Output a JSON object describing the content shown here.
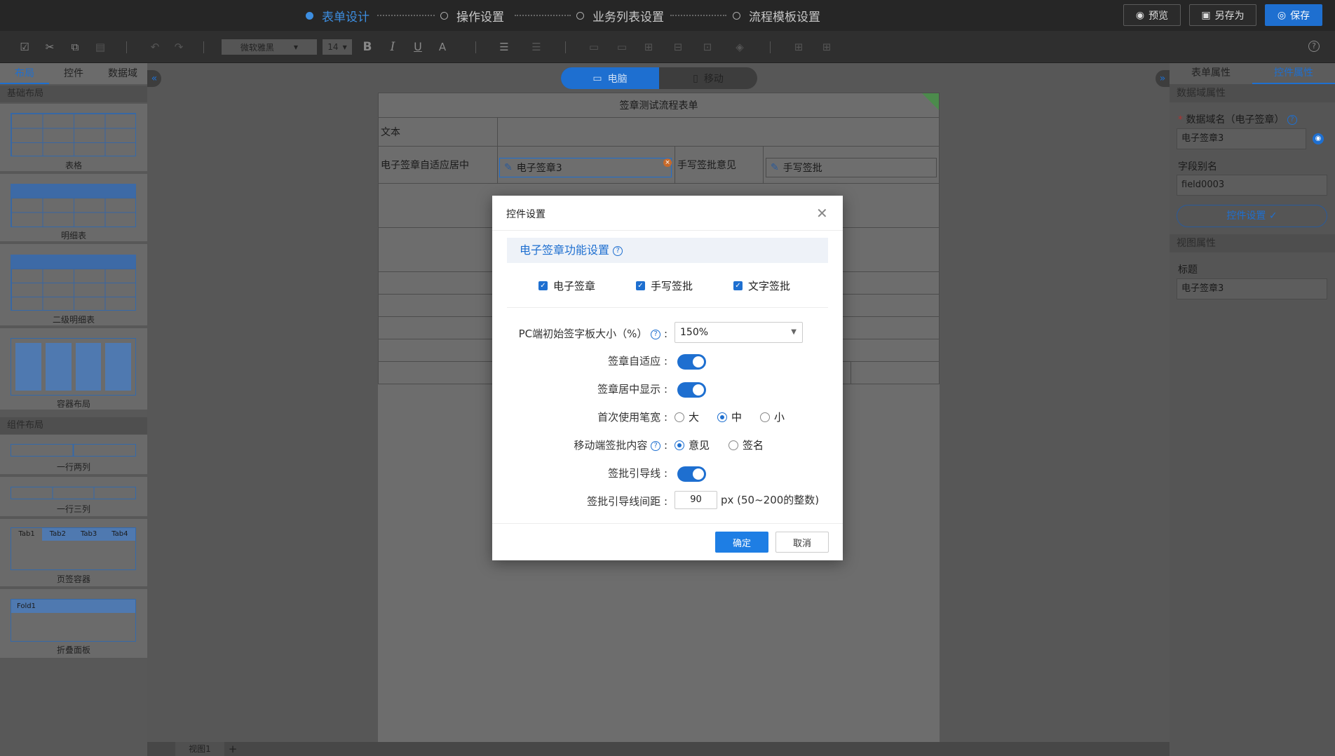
{
  "steps": [
    "表单设计",
    "操作设置",
    "业务列表设置",
    "流程模板设置"
  ],
  "top_buttons": {
    "preview": "预览",
    "save_as": "另存为",
    "save": "保存"
  },
  "toolbar": {
    "font": "微软雅黑",
    "size": "14",
    "bold": "B",
    "italic": "I",
    "underline": "U",
    "color": "A"
  },
  "left": {
    "tabs": [
      "布局",
      "控件",
      "数据域"
    ],
    "basic_section": "基础布局",
    "component_section": "组件布局",
    "items": {
      "table": "表格",
      "detail": "明细表",
      "detail2": "二级明细表",
      "container": "容器布局",
      "row2": "一行两列",
      "row3": "一行三列",
      "tabs": "页签容器",
      "fold": "折叠面板"
    },
    "tab_names": [
      "Tab1",
      "Tab2",
      "Tab3",
      "Tab4"
    ],
    "fold_name": "Fold1"
  },
  "device": {
    "pc": "电脑",
    "mobile": "移动"
  },
  "form": {
    "title": "签章测试流程表单",
    "row1_label": "文本",
    "row2_label": "电子签章自适应居中",
    "sig_control": "电子签章3",
    "handwrite_label": "手写签批意见",
    "handwrite_control": "手写签批"
  },
  "right": {
    "tabs": [
      "表单属性",
      "控件属性"
    ],
    "data_section": "数据域属性",
    "field_name_label": "数据域名（电子签章）",
    "field_name_value": "电子签章3",
    "alias_label": "字段别名",
    "alias_value": "field0003",
    "control_settings_btn": "控件设置 ✓",
    "view_section": "视图属性",
    "title_label": "标题",
    "title_value": "电子签章3"
  },
  "bottom": {
    "view_tab": "视图1",
    "add": "+"
  },
  "modal": {
    "title": "控件设置",
    "section_title": "电子签章功能设置",
    "checkboxes": [
      "电子签章",
      "手写签批",
      "文字签批"
    ],
    "pc_size_label": "PC端初始签字板大小（%）",
    "pc_size_value": "150%",
    "auto_fit_label": "签章自适应",
    "center_label": "签章居中显示",
    "pen_label": "首次使用笔宽",
    "pen_options": [
      "大",
      "中",
      "小"
    ],
    "pen_selected": "中",
    "mobile_label": "移动端签批内容",
    "mobile_options": [
      "意见",
      "签名"
    ],
    "mobile_selected": "意见",
    "guide_label": "签批引导线",
    "gap_label": "签批引导线间距",
    "gap_value": "90",
    "gap_hint": "px (50~200的整数)",
    "ok": "确定",
    "cancel": "取消"
  }
}
